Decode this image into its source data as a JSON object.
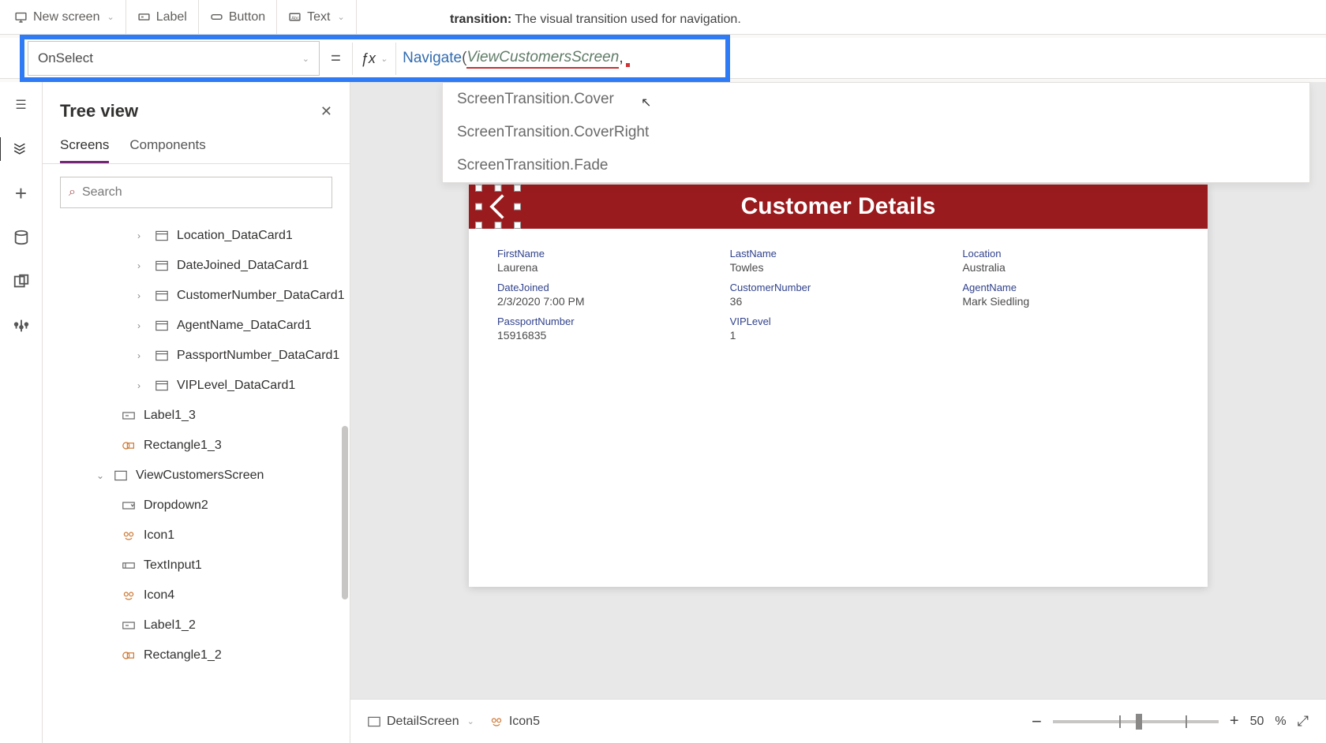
{
  "ribbon": {
    "new_screen": "New screen",
    "label": "Label",
    "button": "Button",
    "text": "Text"
  },
  "tooltip": {
    "key": "transition:",
    "desc": "The visual transition used for navigation."
  },
  "property_selector": "OnSelect",
  "formula": {
    "navigate": "Navigate",
    "open_paren": "(",
    "screen_ref": "ViewCustomersScreen",
    "comma": ","
  },
  "autocomplete": [
    "ScreenTransition.Cover",
    "ScreenTransition.CoverRight",
    "ScreenTransition.Fade"
  ],
  "tree": {
    "title": "Tree view",
    "tabs": {
      "screens": "Screens",
      "components": "Components"
    },
    "search_placeholder": "Search",
    "items": {
      "location": "Location_DataCard1",
      "datejoined": "DateJoined_DataCard1",
      "custnum": "CustomerNumber_DataCard1",
      "agent": "AgentName_DataCard1",
      "passport": "PassportNumber_DataCard1",
      "vip": "VIPLevel_DataCard1",
      "label13": "Label1_3",
      "rect13": "Rectangle1_3",
      "screen": "ViewCustomersScreen",
      "dropdown2": "Dropdown2",
      "icon1": "Icon1",
      "textinput1": "TextInput1",
      "icon4": "Icon4",
      "label12": "Label1_2",
      "rect12": "Rectangle1_2"
    }
  },
  "preview": {
    "title": "Customer Details",
    "fields": {
      "firstname_l": "FirstName",
      "firstname_v": "Laurena",
      "lastname_l": "LastName",
      "lastname_v": "Towles",
      "location_l": "Location",
      "location_v": "Australia",
      "datejoined_l": "DateJoined",
      "datejoined_v": "2/3/2020 7:00 PM",
      "custnum_l": "CustomerNumber",
      "custnum_v": "36",
      "agent_l": "AgentName",
      "agent_v": "Mark Siedling",
      "passport_l": "PassportNumber",
      "passport_v": "15916835",
      "vip_l": "VIPLevel",
      "vip_v": "1"
    }
  },
  "breadcrumb": {
    "screen": "DetailScreen",
    "control": "Icon5"
  },
  "zoom": {
    "value": "50",
    "unit": "%"
  }
}
